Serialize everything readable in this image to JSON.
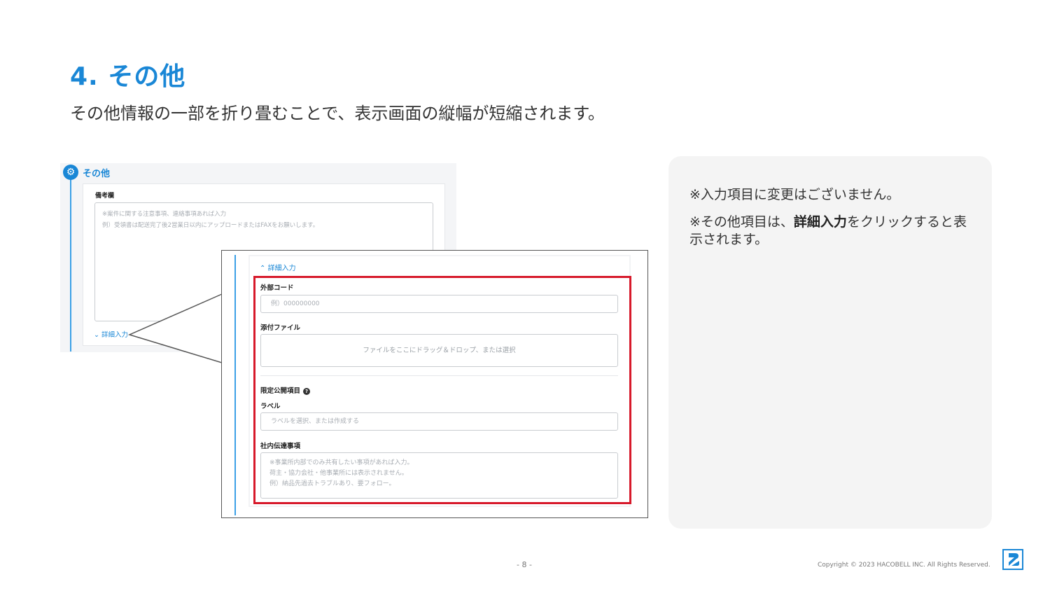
{
  "header": {
    "title": "4. その他",
    "subtitle": "その他情報の一部を折り畳むことで、表示画面の縦幅が短縮されます。"
  },
  "background_screenshot": {
    "section_title": "その他",
    "remarks_label": "備考欄",
    "remarks_placeholder": "※案件に関する注意事項、連絡事項あれば入力\n例）受領書は配送完了後2営業日以内にアップロードまたはFAXをお願いします。",
    "detail_link": "詳細入力"
  },
  "zoom": {
    "detail_link": "詳細入力",
    "external_code": {
      "label": "外部コード",
      "placeholder": "例）000000000"
    },
    "attachment": {
      "label": "添付ファイル",
      "drop_text": "ファイルをここにドラッグ＆ドロップ、または選択"
    },
    "limited_section": {
      "label": "限定公開項目"
    },
    "label_field": {
      "label": "ラベル",
      "placeholder": "ラベルを選択、または作成する"
    },
    "internal_notes": {
      "label": "社内伝達事項",
      "placeholder": "※事業所内部でのみ共有したい事項があれば入力。\n荷主・協力会社・他事業所には表示されません。\n例）納品先過去トラブルあり、要フォロー。"
    }
  },
  "notes": {
    "note1": "※入力項目に変更はございません。",
    "note2_prefix": "※その他項目は、",
    "note2_bold": "詳細入力",
    "note2_suffix": "をクリックすると表示されます。"
  },
  "footer": {
    "page_number": "- 8 -",
    "copyright": "Copyright © 2023 HACOBELL INC. All Rights Reserved."
  },
  "colors": {
    "accent": "#1a87d6",
    "highlight_frame": "#d7192a",
    "panel_bg": "#f4f4f4"
  }
}
